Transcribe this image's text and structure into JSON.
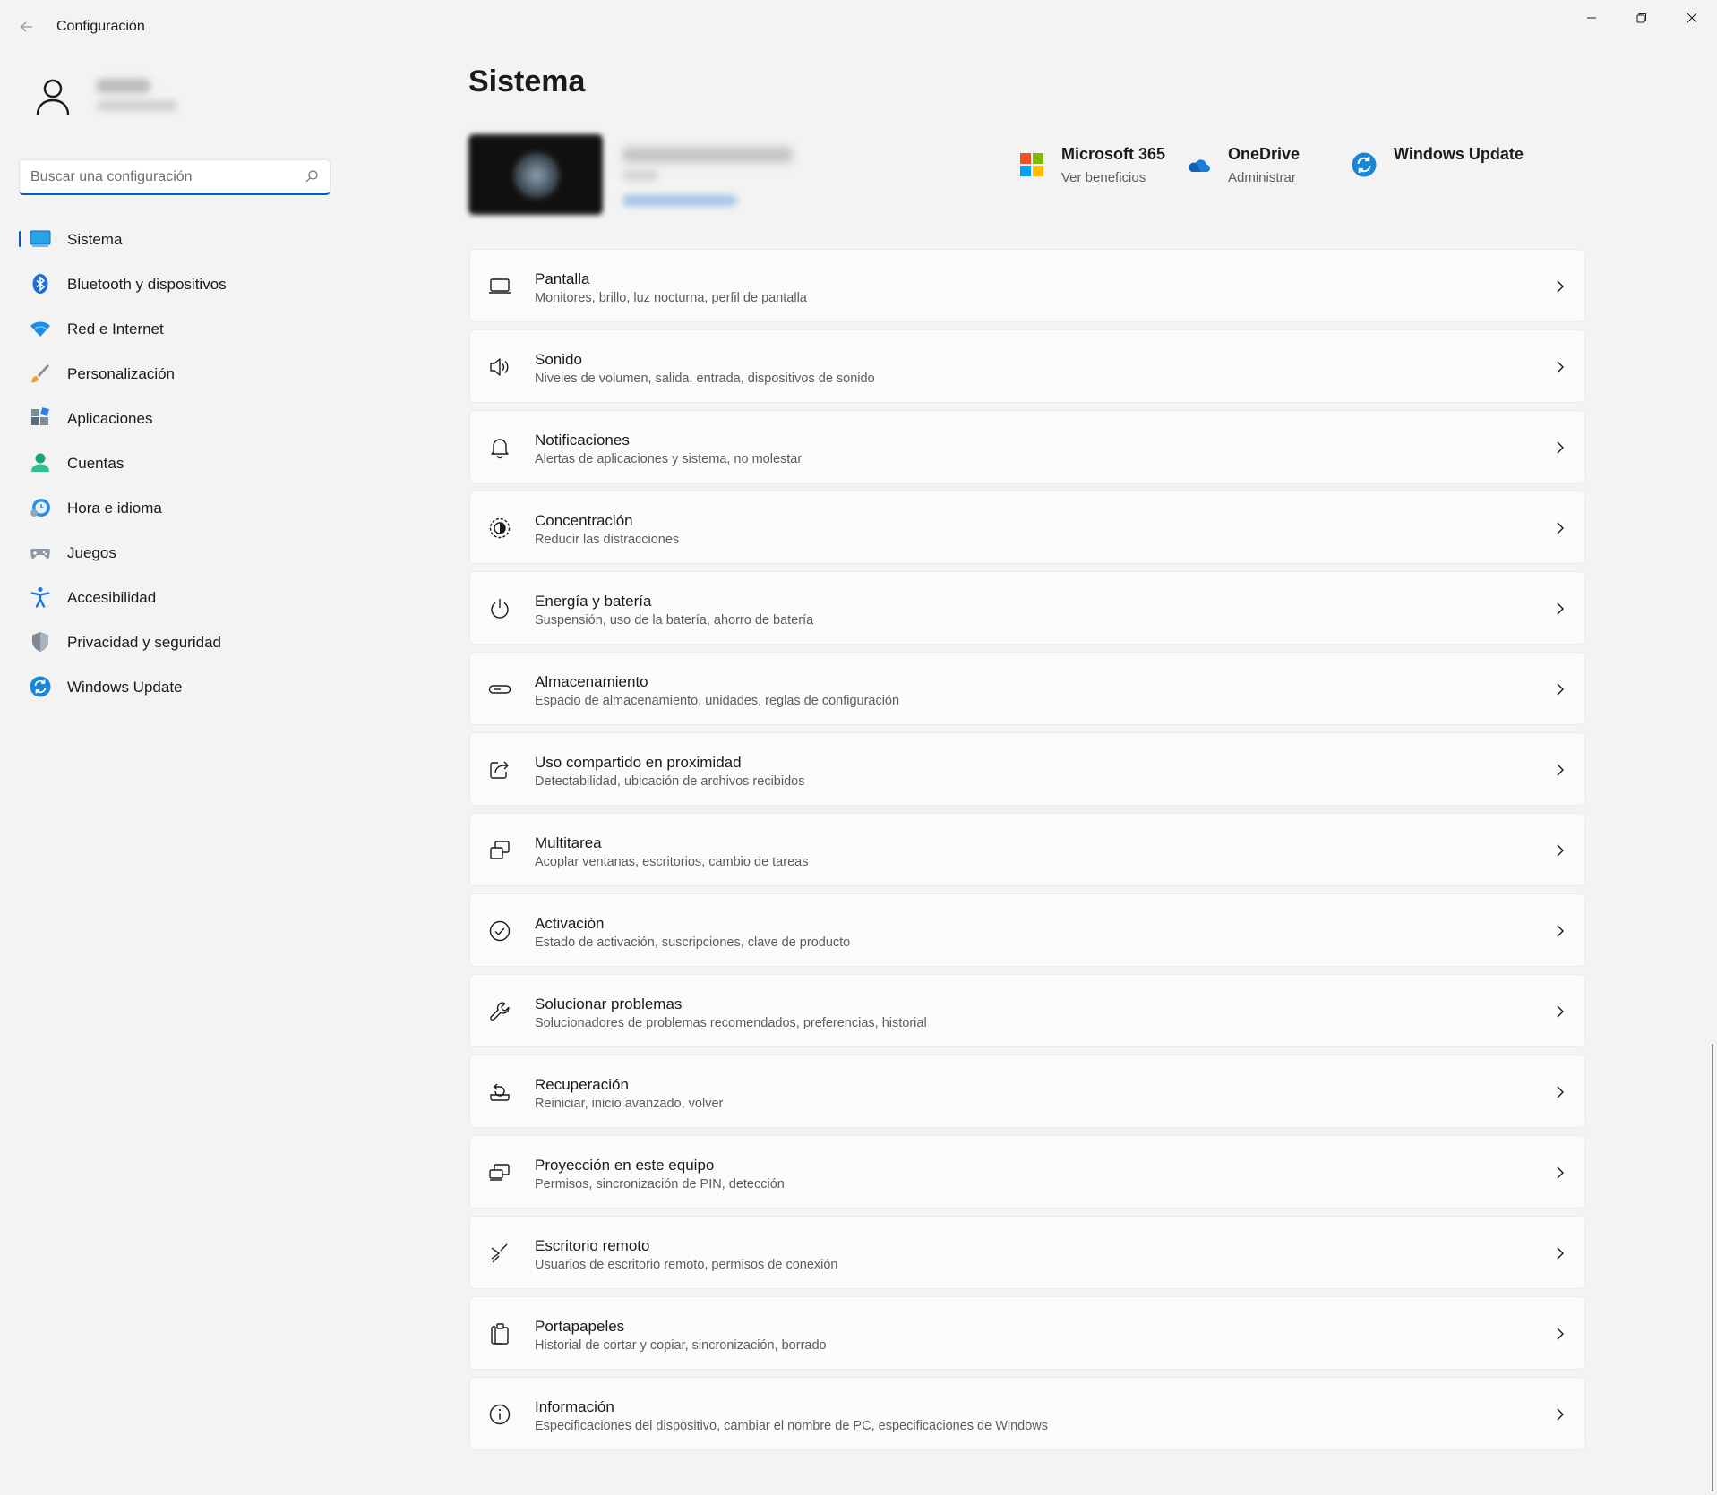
{
  "window": {
    "title": "Configuración",
    "back_icon": "back-arrow-icon",
    "controls": [
      "minimize-icon",
      "restore-icon",
      "close-icon"
    ]
  },
  "search": {
    "placeholder": "Buscar una configuración",
    "value": ""
  },
  "sidebar": {
    "items": [
      {
        "label": "Sistema",
        "icon": "system-icon",
        "active": true
      },
      {
        "label": "Bluetooth y dispositivos",
        "icon": "bluetooth-icon"
      },
      {
        "label": "Red e Internet",
        "icon": "wifi-icon"
      },
      {
        "label": "Personalización",
        "icon": "brush-icon"
      },
      {
        "label": "Aplicaciones",
        "icon": "apps-icon"
      },
      {
        "label": "Cuentas",
        "icon": "account-icon"
      },
      {
        "label": "Hora e idioma",
        "icon": "time-language-icon"
      },
      {
        "label": "Juegos",
        "icon": "gamepad-icon"
      },
      {
        "label": "Accesibilidad",
        "icon": "accessibility-icon"
      },
      {
        "label": "Privacidad y seguridad",
        "icon": "shield-icon"
      },
      {
        "label": "Windows Update",
        "icon": "windows-update-icon"
      }
    ]
  },
  "main": {
    "title": "Sistema",
    "quick_links": [
      {
        "title": "Microsoft 365",
        "subtitle": "Ver beneficios",
        "icon": "microsoft-365-icon"
      },
      {
        "title": "OneDrive",
        "subtitle": "Administrar",
        "icon": "onedrive-icon"
      },
      {
        "title": "Windows Update",
        "subtitle": "",
        "icon": "windows-update-icon"
      }
    ],
    "settings": [
      {
        "title": "Pantalla",
        "subtitle": "Monitores, brillo, luz nocturna, perfil de pantalla",
        "icon": "display-icon"
      },
      {
        "title": "Sonido",
        "subtitle": "Niveles de volumen, salida, entrada, dispositivos de sonido",
        "icon": "speaker-icon"
      },
      {
        "title": "Notificaciones",
        "subtitle": "Alertas de aplicaciones y sistema, no molestar",
        "icon": "bell-icon"
      },
      {
        "title": "Concentración",
        "subtitle": "Reducir las distracciones",
        "icon": "focus-icon"
      },
      {
        "title": "Energía y batería",
        "subtitle": "Suspensión, uso de la batería, ahorro de batería",
        "icon": "power-icon"
      },
      {
        "title": "Almacenamiento",
        "subtitle": "Espacio de almacenamiento, unidades, reglas de configuración",
        "icon": "storage-icon"
      },
      {
        "title": "Uso compartido en proximidad",
        "subtitle": "Detectabilidad, ubicación de archivos recibidos",
        "icon": "share-icon"
      },
      {
        "title": "Multitarea",
        "subtitle": "Acoplar ventanas, escritorios, cambio de tareas",
        "icon": "multitask-icon"
      },
      {
        "title": "Activación",
        "subtitle": "Estado de activación, suscripciones, clave de producto",
        "icon": "check-circle-icon"
      },
      {
        "title": "Solucionar problemas",
        "subtitle": "Solucionadores de problemas recomendados, preferencias, historial",
        "icon": "wrench-icon"
      },
      {
        "title": "Recuperación",
        "subtitle": "Reiniciar, inicio avanzado, volver",
        "icon": "recovery-icon"
      },
      {
        "title": "Proyección en este equipo",
        "subtitle": "Permisos, sincronización de PIN, detección",
        "icon": "projection-icon"
      },
      {
        "title": "Escritorio remoto",
        "subtitle": "Usuarios de escritorio remoto, permisos de conexión",
        "icon": "remote-desktop-icon"
      },
      {
        "title": "Portapapeles",
        "subtitle": "Historial de cortar y copiar, sincronización, borrado",
        "icon": "clipboard-icon"
      },
      {
        "title": "Información",
        "subtitle": "Especificaciones del dispositivo, cambiar el nombre de PC, especificaciones de Windows",
        "icon": "info-icon"
      }
    ]
  },
  "colors": {
    "accent": "#005fb8",
    "background": "#f3f3f3",
    "card": "#fbfbfb"
  }
}
